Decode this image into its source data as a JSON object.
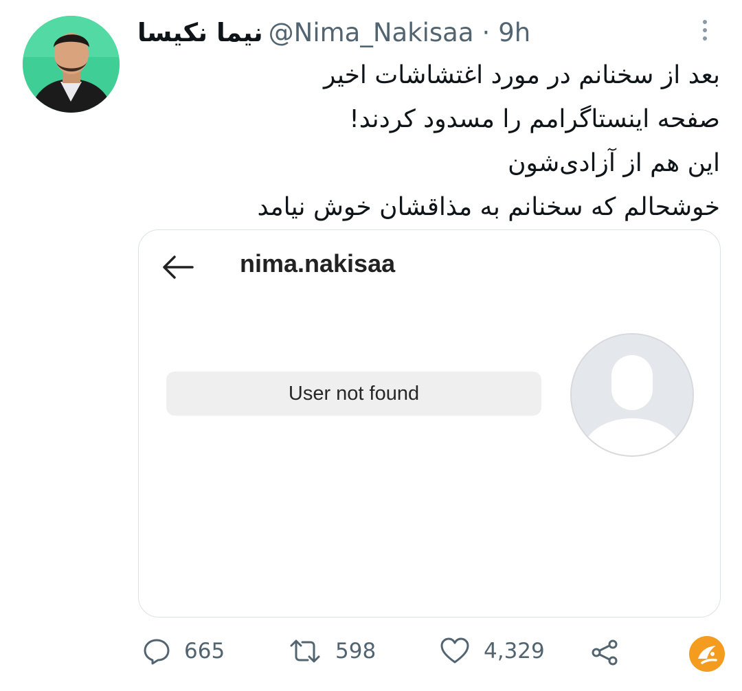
{
  "tweet": {
    "display_name": "نیما نکیسا",
    "handle": "@Nima_Nakisaa",
    "separator": "·",
    "time": "9h",
    "lines": [
      "بعد از سخنانم در مورد اغتشاشات اخیر",
      "صفحه اینستاگرامم را مسدود کردند!",
      "این هم از آزادی‌شون",
      "خوشحالم که سخنانم به مذاقشان خوش نیامد"
    ]
  },
  "media": {
    "username": "nima.nakisaa",
    "not_found": "User not found"
  },
  "actions": {
    "replies": "665",
    "retweets": "598",
    "likes": "4,329"
  },
  "icons": {
    "more": "more-vertical-icon",
    "back": "arrow-left-icon",
    "reply": "reply-icon",
    "retweet": "retweet-icon",
    "like": "heart-icon",
    "share": "share-icon",
    "logo": "watermark-logo-icon"
  },
  "colors": {
    "text": "#0f1419",
    "muted": "#536471",
    "avatar_bg": "#3fcf96",
    "logo": "#f39c1f",
    "border": "#dbe2e7"
  }
}
